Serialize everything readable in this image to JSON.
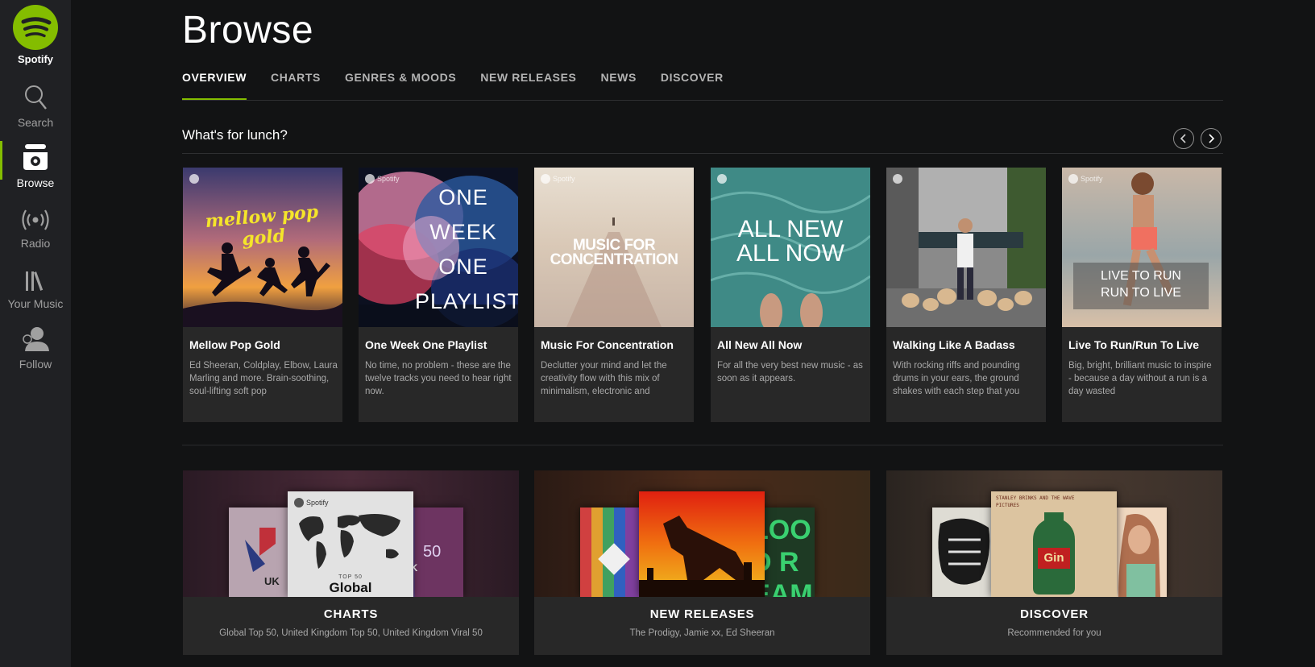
{
  "app": {
    "logo_text": "Spotify"
  },
  "sidebar": {
    "items": [
      {
        "label": "Search",
        "icon": "search-icon"
      },
      {
        "label": "Browse",
        "icon": "browse-icon",
        "active": true
      },
      {
        "label": "Radio",
        "icon": "radio-icon"
      },
      {
        "label": "Your Music",
        "icon": "library-icon"
      },
      {
        "label": "Follow",
        "icon": "follow-icon"
      }
    ]
  },
  "page": {
    "title": "Browse"
  },
  "tabs": [
    {
      "label": "OVERVIEW",
      "active": true
    },
    {
      "label": "CHARTS"
    },
    {
      "label": "GENRES & MOODS"
    },
    {
      "label": "NEW RELEASES"
    },
    {
      "label": "NEWS"
    },
    {
      "label": "DISCOVER"
    }
  ],
  "section": {
    "title": "What's for lunch?"
  },
  "cards": [
    {
      "title": "Mellow Pop Gold",
      "desc": "Ed Sheeran, Coldplay, Elbow, Laura Marling and more. Brain-soothing, soul-lifting soft pop",
      "art_text": "mellow pop gold"
    },
    {
      "title": "One Week One Playlist",
      "desc": "No time, no problem - these are the twelve tracks you need to hear right now.",
      "art_text": "ONE WEEK ONE PLAYLIST"
    },
    {
      "title": "Music For Concentration",
      "desc": "Declutter your mind and let the creativity flow with this mix of minimalism, electronic and",
      "art_text": "MUSIC FOR CONCENTRATION"
    },
    {
      "title": "All New All Now",
      "desc": "For all the very best new music - as soon as it appears.",
      "art_text": "ALL NEW ALL NOW"
    },
    {
      "title": "Walking Like A Badass",
      "desc": "With rocking riffs and pounding drums in your ears, the ground shakes with each step that you",
      "art_text": ""
    },
    {
      "title": "Live To Run/Run To Live",
      "desc": "Big, bright, brilliant music to inspire - because a day without a run is a day wasted",
      "art_text": "LIVE TO RUN RUN TO LIVE"
    }
  ],
  "badge_text": "Spotify",
  "categories": [
    {
      "title": "CHARTS",
      "subtitle": "Global Top 50, United Kingdom Top 50, United Kingdom Viral 50",
      "art": {
        "left": "UK",
        "center_top": "TOP 50",
        "center": "Global",
        "right": "UK",
        "right_num": "50"
      }
    },
    {
      "title": "NEW RELEASES",
      "subtitle": "The Prodigy, Jamie xx, Ed Sheeran",
      "art": {
        "right": "LOOD REAM"
      }
    },
    {
      "title": "DISCOVER",
      "subtitle": "Recommended for you",
      "art": {
        "center_top": "STANLEY BRINKS AND THE WAVE PICTURES",
        "center": "Gin"
      }
    }
  ],
  "colors": {
    "accent": "#84bd00",
    "background": "#121314",
    "sidebar": "#202124",
    "card": "#282828"
  }
}
